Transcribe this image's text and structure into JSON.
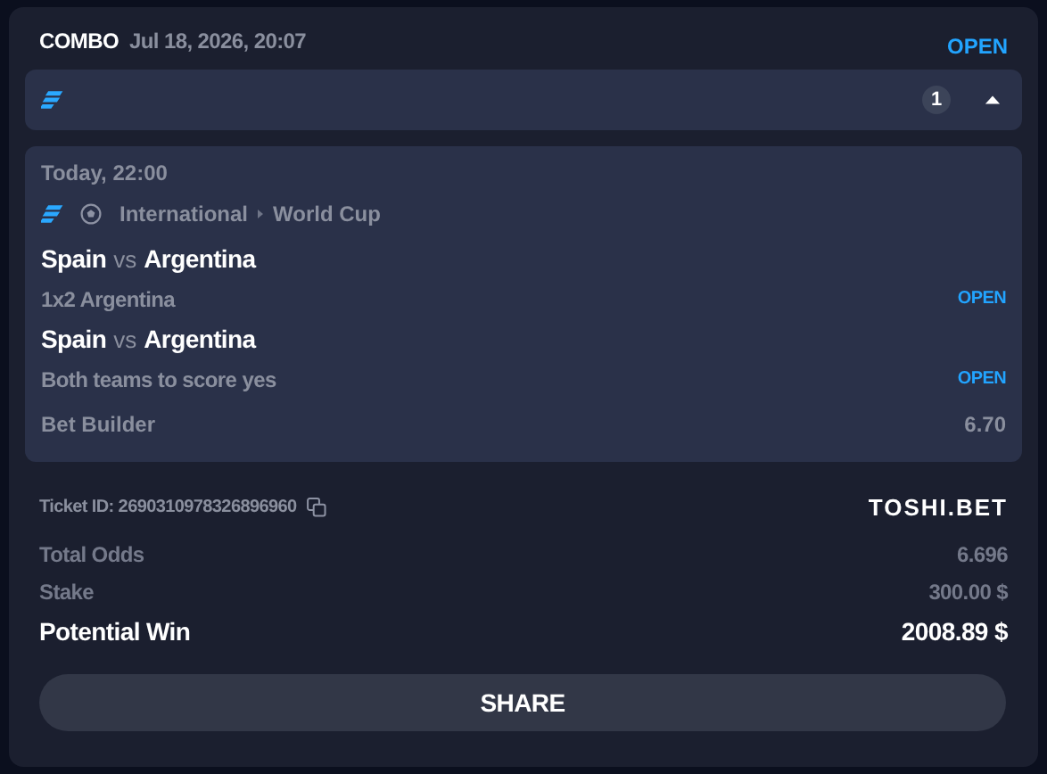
{
  "header": {
    "type": "COMBO",
    "date": "Jul 18, 2026, 20:07",
    "status": "OPEN"
  },
  "group": {
    "count": "1",
    "expanded": true
  },
  "event": {
    "time": "Today, 22:00",
    "region": "International",
    "league": "World Cup"
  },
  "legs": [
    {
      "home": "Spain",
      "sep": "vs",
      "away": "Argentina",
      "market": "1x2 Argentina",
      "status": "OPEN"
    },
    {
      "home": "Spain",
      "sep": "vs",
      "away": "Argentina",
      "market": "Both teams to score yes",
      "status": "OPEN"
    }
  ],
  "builder": {
    "label": "Bet Builder",
    "odds": "6.70"
  },
  "ticket": {
    "label": "Ticket ID: 2690310978326896960",
    "brand": "TOSHI.BET"
  },
  "summary": [
    {
      "label": "Total Odds",
      "value": "6.696",
      "kind": "muted"
    },
    {
      "label": "Stake",
      "value": "300.00 $",
      "kind": "muted"
    },
    {
      "label": "Potential Win",
      "value": "2008.89 $",
      "kind": "strong"
    }
  ],
  "share": "SHARE"
}
